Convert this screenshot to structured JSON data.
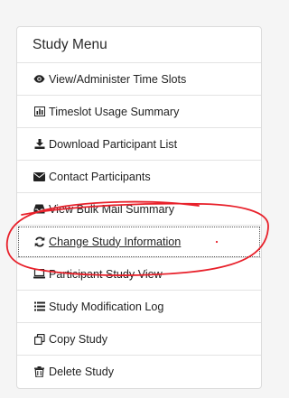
{
  "menu": {
    "title": "Study Menu",
    "items": [
      {
        "label": "View/Administer Time Slots",
        "icon": "eye-icon"
      },
      {
        "label": "Timeslot Usage Summary",
        "icon": "bar-chart-icon"
      },
      {
        "label": "Download Participant List",
        "icon": "download-icon"
      },
      {
        "label": "Contact Participants",
        "icon": "envelope-icon"
      },
      {
        "label": "View Bulk Mail Summary",
        "icon": "inbox-icon"
      },
      {
        "label": "Change Study Information",
        "icon": "refresh-icon"
      },
      {
        "label": "Participant Study View",
        "icon": "laptop-icon"
      },
      {
        "label": "Study Modification Log",
        "icon": "list-icon"
      },
      {
        "label": "Copy Study",
        "icon": "copy-icon"
      },
      {
        "label": "Delete Study",
        "icon": "trash-icon"
      }
    ]
  },
  "annotation": {
    "color": "#e8202a"
  }
}
